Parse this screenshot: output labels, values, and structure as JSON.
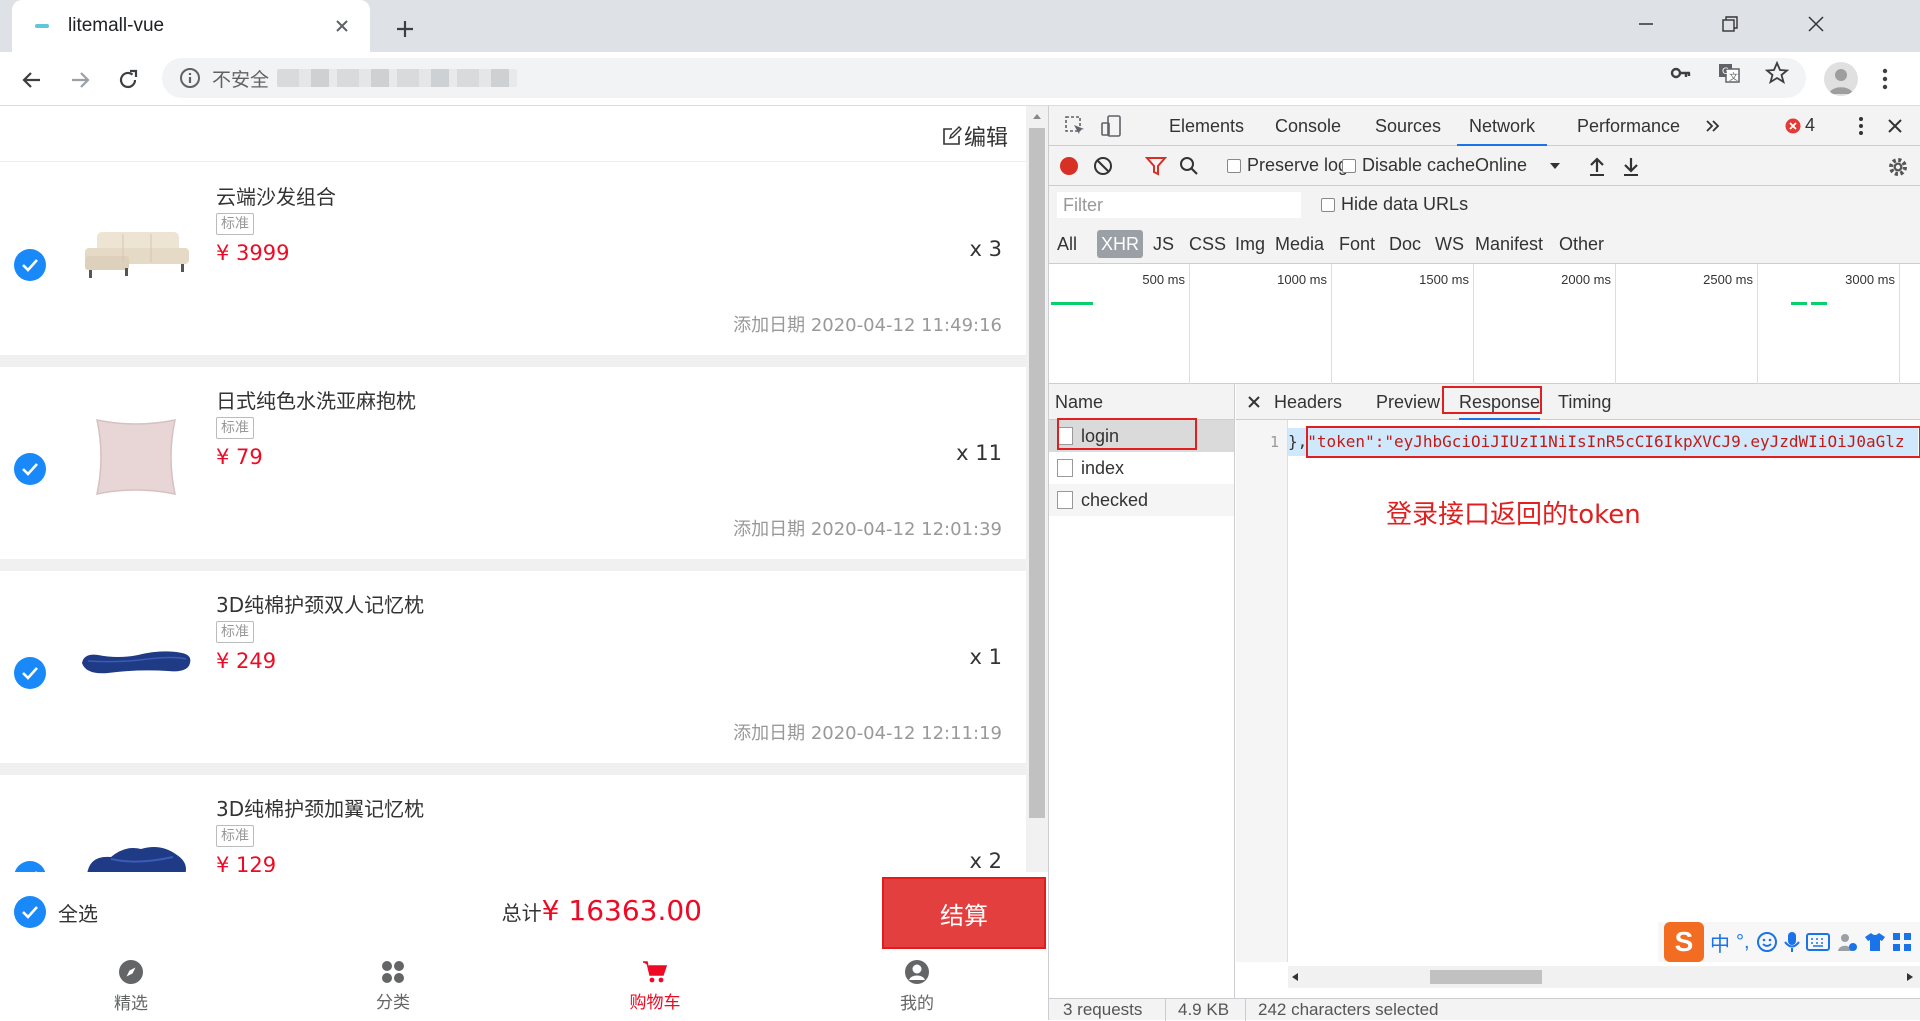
{
  "browser": {
    "tab_title": "litemall-vue",
    "security_label": "不安全"
  },
  "cart": {
    "edit_label": "编辑",
    "items": [
      {
        "name": "云端沙发组合",
        "tag": "标准",
        "price": "¥ 3999",
        "qty": "x 3",
        "date": "添加日期 2020-04-12 11:49:16"
      },
      {
        "name": "日式纯色水洗亚麻抱枕",
        "tag": "标准",
        "price": "¥ 79",
        "qty": "x 11",
        "date": "添加日期 2020-04-12 12:01:39"
      },
      {
        "name": "3D纯棉护颈双人记忆枕",
        "tag": "标准",
        "price": "¥ 249",
        "qty": "x 1",
        "date": "添加日期 2020-04-12 12:11:19"
      },
      {
        "name": "3D纯棉护颈加翼记忆枕",
        "tag": "标准",
        "price": "¥ 129",
        "qty": "x 2",
        "date": ""
      }
    ],
    "select_all": "全选",
    "total_label": "总计",
    "total_value": "¥ 16363.00",
    "checkout": "结算"
  },
  "tabbar": {
    "items": [
      {
        "label": "精选"
      },
      {
        "label": "分类"
      },
      {
        "label": "购物车"
      },
      {
        "label": "我的"
      }
    ]
  },
  "devtools": {
    "tabs": [
      "Elements",
      "Console",
      "Sources",
      "Network",
      "Performance"
    ],
    "active_tab": "Network",
    "error_count": "4",
    "preserve_log": "Preserve log",
    "disable_cache": "Disable cache",
    "throttle": "Online",
    "filter_placeholder": "Filter",
    "hide_data_urls": "Hide data URLs",
    "type_filters": [
      "All",
      "XHR",
      "JS",
      "CSS",
      "Img",
      "Media",
      "Font",
      "Doc",
      "WS",
      "Manifest",
      "Other"
    ],
    "timeline_labels": [
      "500 ms",
      "1000 ms",
      "1500 ms",
      "2000 ms",
      "2500 ms",
      "3000 ms"
    ],
    "name_header": "Name",
    "requests": [
      "login",
      "index",
      "checked"
    ],
    "detail_tabs": [
      "Headers",
      "Preview",
      "Response",
      "Timing"
    ],
    "line_number": "1",
    "response_prefix": "},",
    "response_text": "\"token\":\"eyJhbGciOiJIUzI1NiIsInR5cCI6IkpXVCJ9.eyJzdWIiOiJ0aGlz",
    "annotation": "登录接口返回的token",
    "ime": {
      "lang": "中",
      "punct": "°,"
    },
    "status": {
      "requests": "3 requests",
      "size": "4.9 KB",
      "selection": "242 characters selected"
    }
  }
}
